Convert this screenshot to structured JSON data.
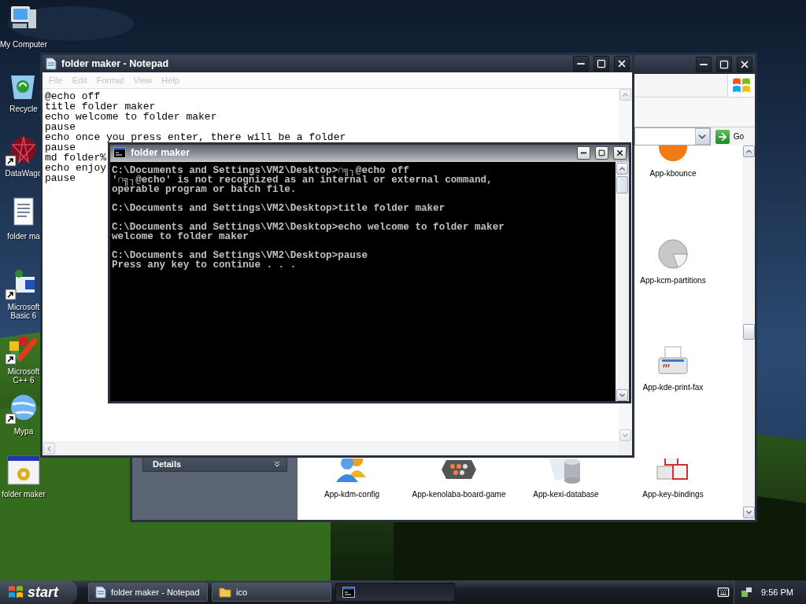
{
  "desktop_icons": [
    {
      "label_lines": [
        "My Computer"
      ],
      "kind": "computer",
      "shortcut": false
    },
    {
      "label_lines": [
        "Recycle"
      ],
      "kind": "recycle",
      "shortcut": false
    },
    {
      "label_lines": [
        "DataWago"
      ],
      "kind": "web",
      "shortcut": true
    },
    {
      "label_lines": [
        "folder ma"
      ],
      "kind": "document",
      "shortcut": false
    },
    {
      "label_lines": [
        "Microsoft",
        "Basic 6"
      ],
      "kind": "basic",
      "shortcut": true
    },
    {
      "label_lines": [
        "Microsoft",
        "C++ 6"
      ],
      "kind": "cpp",
      "shortcut": true
    },
    {
      "label_lines": [
        "Mypa"
      ],
      "kind": "globe",
      "shortcut": true
    },
    {
      "label_lines": [
        "folder maker"
      ],
      "kind": "batch",
      "shortcut": false
    }
  ],
  "explorer": {
    "active": false,
    "go": "Go",
    "details": {
      "title": "Details",
      "expanded": false
    },
    "items": [
      {
        "label": "App-kbounce",
        "kind": "ball"
      },
      {
        "label": "App-kcm-partitions",
        "kind": "disk"
      },
      {
        "label": "App-kde-print-fax",
        "kind": "fax"
      },
      {
        "label": "App-kdm-config",
        "kind": "users"
      },
      {
        "label": "App-kenolaba-board-game",
        "kind": "board"
      },
      {
        "label": "App-kexi-database",
        "kind": "database"
      },
      {
        "label": "App-key-bindings",
        "kind": "keys"
      }
    ]
  },
  "notepad": {
    "title": "folder maker - Notepad",
    "active": false,
    "menu": [
      {
        "label": "File",
        "disabled": true
      },
      {
        "label": "Edit",
        "disabled": true
      },
      {
        "label": "Format",
        "disabled": true
      },
      {
        "label": "View",
        "disabled": true
      },
      {
        "label": "Help",
        "disabled": true
      }
    ],
    "lines": [
      "@echo off",
      "title folder maker",
      "echo welcome to folder maker",
      "pause",
      "echo once you press enter, there will be a folder",
      "pause",
      "md folder%",
      "echo enjoy",
      "pause"
    ]
  },
  "console": {
    "title": "folder maker",
    "active": true,
    "blocks": [
      [
        "C:\\Documents and Settings\\VM2\\Desktop>∩╗┐@echo off",
        "'∩╗┐@echo' is not recognized as an internal or external command,",
        "operable program or batch file."
      ],
      [
        "C:\\Documents and Settings\\VM2\\Desktop>title folder maker"
      ],
      [
        "C:\\Documents and Settings\\VM2\\Desktop>echo welcome to folder maker",
        "welcome to folder maker"
      ],
      [
        "C:\\Documents and Settings\\VM2\\Desktop>pause",
        "Press any key to continue . . ."
      ]
    ]
  },
  "taskbar": {
    "start": "start",
    "tasks": [
      {
        "label": "folder maker - Notepad",
        "kind": "notepad",
        "selected": false
      },
      {
        "label": "ico",
        "kind": "folder",
        "selected": false
      },
      {
        "kind": "console",
        "selected": true
      }
    ],
    "clock": "9:56 PM"
  }
}
